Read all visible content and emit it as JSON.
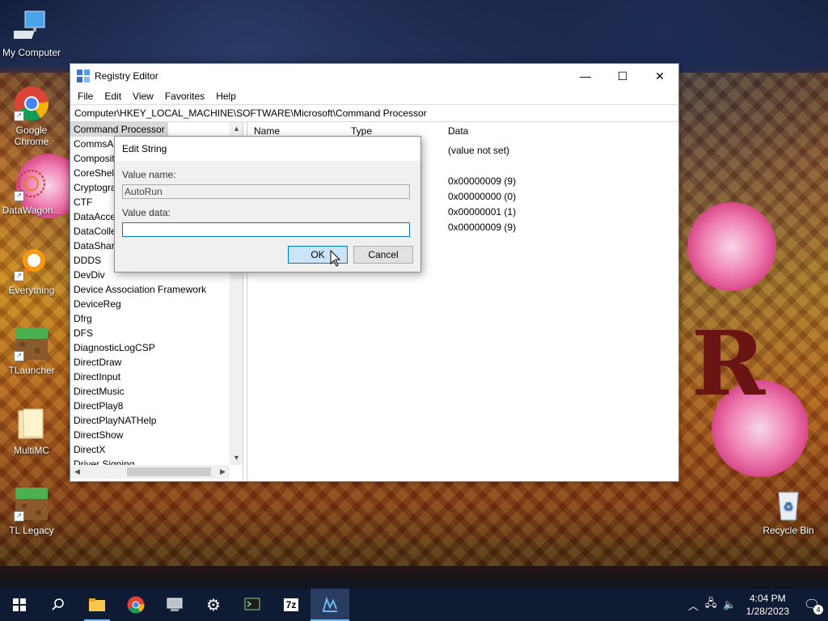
{
  "desktop": {
    "icons": [
      {
        "label": "My Computer"
      },
      {
        "label": "Google Chrome"
      },
      {
        "label": "DataWagon..."
      },
      {
        "label": "Everything"
      },
      {
        "label": "TLauncher"
      },
      {
        "label": "MultiMC"
      },
      {
        "label": "TL Legacy"
      },
      {
        "label": "Recycle Bin"
      }
    ],
    "wallpaper_letter": "R"
  },
  "window": {
    "title": "Registry Editor",
    "controls": {
      "minimize": "—",
      "maximize": "☐",
      "close": "✕"
    },
    "menu": [
      "File",
      "Edit",
      "View",
      "Favorites",
      "Help"
    ],
    "address": "Computer\\HKEY_LOCAL_MACHINE\\SOFTWARE\\Microsoft\\Command Processor",
    "tree": [
      "Command Processor",
      "CommsAPI",
      "Composition",
      "CoreShell",
      "Cryptography",
      "CTF",
      "DataAccess",
      "DataCollection",
      "DataSharing",
      "DDDS",
      "DevDiv",
      "Device Association Framework",
      "DeviceReg",
      "Dfrg",
      "DFS",
      "DiagnosticLogCSP",
      "DirectDraw",
      "DirectInput",
      "DirectMusic",
      "DirectPlay8",
      "DirectPlayNATHelp",
      "DirectShow",
      "DirectX",
      "Driver Signing"
    ],
    "list": {
      "columns": {
        "name": "Name",
        "type": "Type",
        "data": "Data"
      },
      "data_values": [
        "(value not set)",
        "0x00000009 (9)",
        "0x00000000 (0)",
        "0x00000001 (1)",
        "0x00000009 (9)"
      ]
    }
  },
  "dialog": {
    "title": "Edit String",
    "value_name_label": "Value name:",
    "value_name": "AutoRun",
    "value_data_label": "Value data:",
    "value_data": "",
    "ok_label": "OK",
    "cancel_label": "Cancel"
  },
  "taskbar": {
    "apps": [
      "start-icon",
      "search-icon",
      "file-explorer-icon",
      "chrome-icon",
      "device-icon",
      "settings-icon",
      "terminal-icon",
      "7zip-icon",
      "regedit-icon"
    ],
    "sevenzip_text": "7z",
    "clock_time": "4:04 PM",
    "clock_date": "1/28/2023",
    "notification_count": "4"
  },
  "colors": {
    "accent": "#0078d7",
    "taskbar": "#0f1b33"
  }
}
